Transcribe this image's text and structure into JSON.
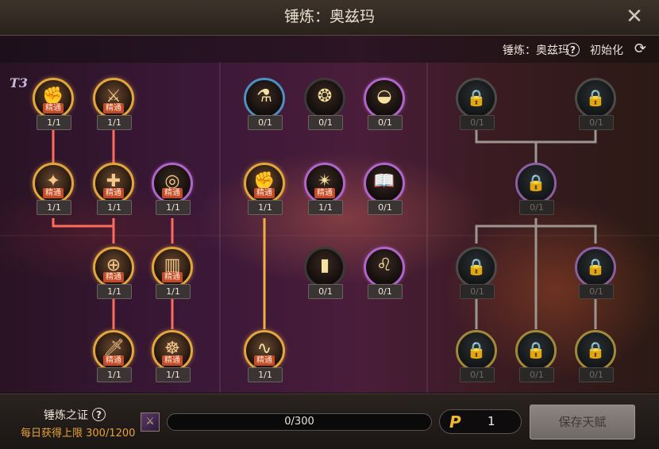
{
  "window": {
    "title": "锤炼：奥兹玛",
    "close_icon": "close-icon"
  },
  "header": {
    "class_label": "锤炼：奥兹玛",
    "help_glyph": "?",
    "reset_label": "初始化",
    "reset_icon": "refresh-icon"
  },
  "tier_label": "T3",
  "nodes": [
    {
      "id": "n1",
      "tag": "精通",
      "count": "1/1",
      "icon": "burst-fist-icon"
    },
    {
      "id": "n2",
      "tag": "精通",
      "count": "1/1",
      "icon": "cross-blades-icon"
    },
    {
      "id": "n3",
      "tag": "精通",
      "count": "1/1",
      "icon": "spark-strike-icon"
    },
    {
      "id": "n4",
      "tag": "精通",
      "count": "1/1",
      "icon": "swirl-plus-icon"
    },
    {
      "id": "n5",
      "tag": "精通",
      "count": "1/1",
      "icon": "vortex-ring-icon"
    },
    {
      "id": "n6",
      "tag": "精通",
      "count": "1/1",
      "icon": "crosshair-plus-icon"
    },
    {
      "id": "n7",
      "tag": "精通",
      "count": "1/1",
      "icon": "door-figure-icon"
    },
    {
      "id": "n8",
      "tag": "精通",
      "count": "1/1",
      "icon": "greatsword-icon"
    },
    {
      "id": "n9",
      "tag": "精通",
      "count": "1/1",
      "icon": "demon-sigil-icon"
    },
    {
      "id": "n10",
      "tag": "",
      "count": "0/1",
      "icon": "potion-icon"
    },
    {
      "id": "n11",
      "tag": "",
      "count": "0/1",
      "icon": "beast-icon"
    },
    {
      "id": "n12",
      "tag": "",
      "count": "0/1",
      "icon": "eclipse-icon"
    },
    {
      "id": "n13",
      "tag": "精通",
      "count": "1/1",
      "icon": "fist-raise-icon"
    },
    {
      "id": "n14",
      "tag": "精通",
      "count": "1/1",
      "icon": "target-star-icon"
    },
    {
      "id": "n15",
      "tag": "",
      "count": "0/1",
      "icon": "tome-icon"
    },
    {
      "id": "n16",
      "tag": "",
      "count": "0/1",
      "icon": "pillar-icon"
    },
    {
      "id": "n17",
      "tag": "",
      "count": "0/1",
      "icon": "lion-icon"
    },
    {
      "id": "n18",
      "tag": "精通",
      "count": "1/1",
      "icon": "serpent-icon"
    },
    {
      "id": "n19",
      "tag": "",
      "count": "0/1",
      "icon": "lock-icon"
    },
    {
      "id": "n20",
      "tag": "",
      "count": "0/1",
      "icon": "lock-icon"
    },
    {
      "id": "n21",
      "tag": "",
      "count": "0/1",
      "icon": "lock-icon"
    },
    {
      "id": "n22",
      "tag": "",
      "count": "0/1",
      "icon": "lock-icon"
    },
    {
      "id": "n23",
      "tag": "",
      "count": "0/1",
      "icon": "lock-icon"
    },
    {
      "id": "n24",
      "tag": "",
      "count": "0/1",
      "icon": "lock-icon"
    },
    {
      "id": "n25",
      "tag": "",
      "count": "0/1",
      "icon": "lock-icon"
    },
    {
      "id": "n26",
      "tag": "",
      "count": "0/1",
      "icon": "lock-icon"
    }
  ],
  "footer": {
    "proof_label": "锤炼之证",
    "daily_limit": "每日获得上限 300/1200",
    "progress_text": "0/300",
    "progress_fraction": 0,
    "points_icon": "P",
    "points_value": "1",
    "save_label": "保存天赋"
  },
  "colors": {
    "mastered": "#e2a63c",
    "locked": "#4d4a48",
    "link_red": "#ff6a5a",
    "link_gold": "#f0b040",
    "link_gray": "#9a9690"
  }
}
